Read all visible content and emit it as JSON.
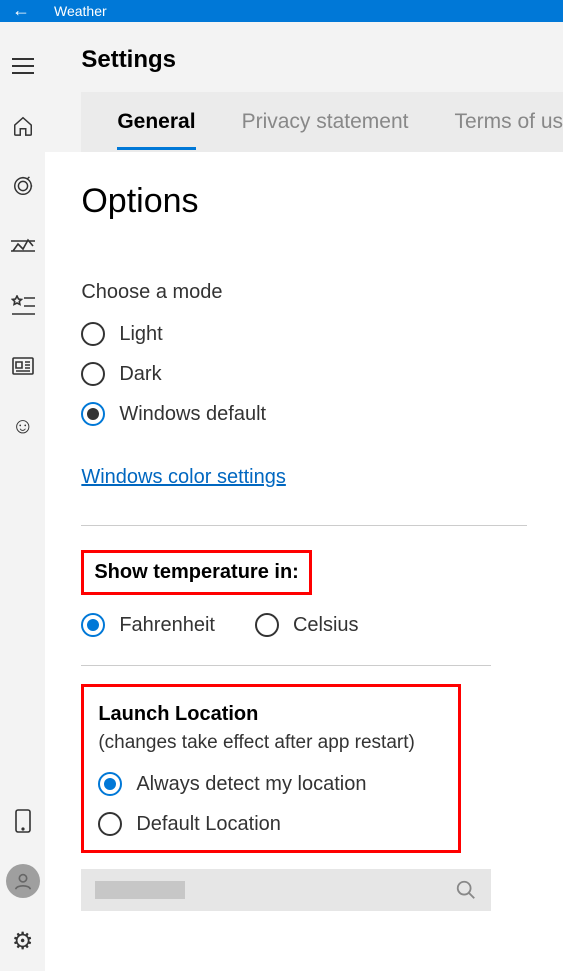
{
  "app": {
    "name": "Weather"
  },
  "header": {
    "title": "Settings"
  },
  "tabs": [
    {
      "label": "General",
      "active": true
    },
    {
      "label": "Privacy statement",
      "active": false
    },
    {
      "label": "Terms of us",
      "active": false
    }
  ],
  "options": {
    "title": "Options",
    "mode": {
      "label": "Choose a mode",
      "items": [
        "Light",
        "Dark",
        "Windows default"
      ],
      "selected": 2,
      "link": "Windows color settings"
    },
    "temp": {
      "label": "Show temperature in:",
      "items": [
        "Fahrenheit",
        "Celsius"
      ],
      "selected": 0
    },
    "launch": {
      "title": "Launch Location",
      "subtitle": "(changes take effect after app restart)",
      "items": [
        "Always detect my location",
        "Default Location"
      ],
      "selected": 0
    }
  }
}
